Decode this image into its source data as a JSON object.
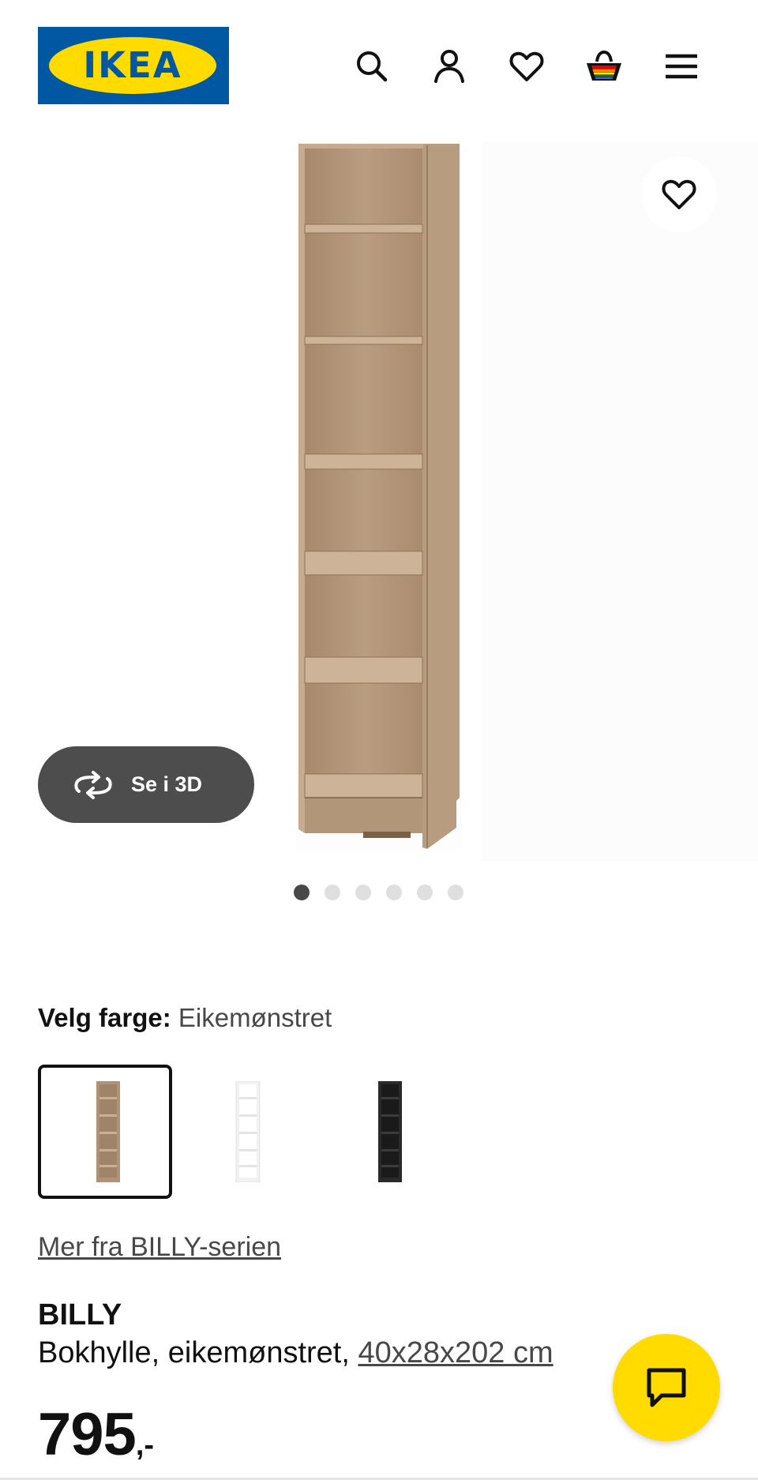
{
  "header": {
    "logo_text": "IKEA",
    "icons": [
      "search-icon",
      "user-icon",
      "heart-icon",
      "shopping-bag-icon",
      "menu-icon"
    ]
  },
  "gallery": {
    "button_3d_label": "Se i 3D",
    "image_count": 6,
    "active_index": 0
  },
  "color_picker": {
    "label": "Velg farge:",
    "selected_value": "Eikemønstret",
    "swatches": [
      "oak",
      "white",
      "black"
    ]
  },
  "series_link": "Mer fra BILLY-serien",
  "product": {
    "name": "BILLY",
    "description": "Bokhylle, eikemønstret, ",
    "dimensions": "40x28x202 cm",
    "price": "795",
    "price_suffix": ",-"
  },
  "colors": {
    "ikea_blue": "#0058a3",
    "ikea_yellow": "#ffdb00",
    "oak": "#b4977a",
    "dark_button": "#4d4d4d"
  }
}
